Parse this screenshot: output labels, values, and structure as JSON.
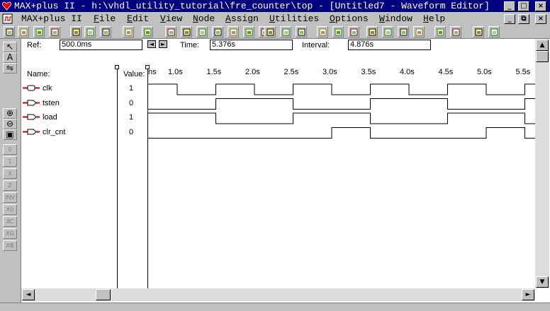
{
  "window": {
    "title": "MAX+plus II - h:\\vhdl_utility_tutorial\\fre_counter\\top - [Untitled7 - Waveform Editor]",
    "minimize": "_",
    "maximize": "□",
    "restore": "⧉",
    "close": "×"
  },
  "menu": [
    {
      "label": "MAX+plus II",
      "accel": ""
    },
    {
      "label": "File",
      "accel": "F"
    },
    {
      "label": "Edit",
      "accel": "E"
    },
    {
      "label": "View",
      "accel": "V"
    },
    {
      "label": "Node",
      "accel": "N"
    },
    {
      "label": "Assign",
      "accel": "A"
    },
    {
      "label": "Utilities",
      "accel": "U"
    },
    {
      "label": "Options",
      "accel": "O"
    },
    {
      "label": "Window",
      "accel": "W"
    },
    {
      "label": "Help",
      "accel": "H"
    }
  ],
  "toolbar_icons": [
    "new-file-icon",
    "open-file-icon",
    "save-icon",
    "print-icon",
    "cut-icon",
    "copy-icon",
    "paste-icon",
    "undo-icon",
    "help-pointer-icon",
    "warning-icon",
    "hierarchy-display-icon",
    "floorplan-icon",
    "compiler-icon",
    "simulator-icon",
    "timing-analyzer-icon",
    "programmer-icon",
    "open-hierarchy-icon",
    "open-parent-icon",
    "open-children-icon",
    "project-set-icon",
    "project-save-check-icon",
    "project-save-compile-icon",
    "project-save-simulate-icon",
    "find-node-icon",
    "find-text-icon",
    "replace-text-icon",
    "find-clique-icon",
    "group-icon",
    "ungroup-icon",
    "zoom-fit-icon"
  ],
  "reference_bar": {
    "ref_label": "Ref:",
    "ref_value": "500.0ms",
    "time_label": "Time:",
    "time_value": "5.376s",
    "interval_label": "Interval:",
    "interval_value": "4.876s"
  },
  "columns": {
    "name": "Name:",
    "value": "Value:"
  },
  "time_ticks": [
    "ns",
    "1.0s",
    "1.5s",
    "2.0s",
    "2.5s",
    "3.0s",
    "3.5s",
    "4.0s",
    "4.5s",
    "5.0s",
    "5.5s"
  ],
  "signals": [
    {
      "name": "clk",
      "value": "1",
      "type": "input",
      "levels": [
        1,
        0,
        1,
        0,
        1,
        0,
        1,
        0,
        1,
        0,
        1
      ]
    },
    {
      "name": "tsten",
      "value": "0",
      "type": "output",
      "levels": [
        0,
        0,
        1,
        1,
        0,
        0,
        1,
        1,
        0,
        0,
        1
      ]
    },
    {
      "name": "load",
      "value": "1",
      "type": "output",
      "levels": [
        1,
        1,
        0,
        0,
        1,
        1,
        0,
        0,
        1,
        1,
        0
      ]
    },
    {
      "name": "clr_cnt",
      "value": "0",
      "type": "output",
      "levels": [
        0,
        0,
        0,
        0,
        0,
        1,
        0,
        0,
        0,
        1,
        0
      ]
    }
  ],
  "palette": [
    "selection-tool",
    "text-tool",
    "zoom-to-fit-tool",
    "zoom-in-tool",
    "zoom-out-tool",
    "fit-in-window-tool",
    "overwrite-0-tool",
    "overwrite-1-tool",
    "overwrite-x-tool",
    "overwrite-z-tool",
    "invert-tool",
    "overwrite-count-tool",
    "overwrite-clock-tool",
    "overwrite-group-tool",
    "overwrite-value-tool"
  ],
  "colors": {
    "titlebar": "#000080",
    "input_marker": "#c00000",
    "waveform": "#000000"
  }
}
